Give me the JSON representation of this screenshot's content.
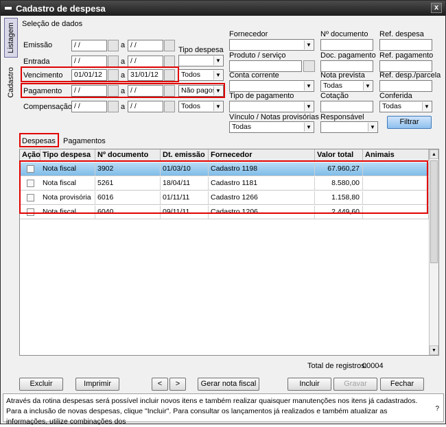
{
  "window": {
    "title": "Cadastro de despesa",
    "close": "x"
  },
  "side_tabs": [
    "Listagem",
    "Cadastro"
  ],
  "section_title": "Seleção de dados",
  "filters": {
    "sep": "a",
    "emissao": {
      "label": "Emissão",
      "from": " / /",
      "to": " / /"
    },
    "entrada": {
      "label": "Entrada",
      "from": " / /",
      "to": " / /"
    },
    "vencimento": {
      "label": "Vencimento",
      "from": "01/01/12",
      "to": "31/01/12",
      "select": "Todos"
    },
    "pagamento": {
      "label": "Pagamento",
      "from": " / /",
      "to": " / /",
      "select": "Não pagos"
    },
    "compensacao": {
      "label": "Compensação",
      "from": " / /",
      "to": " / /",
      "select": "Todos"
    },
    "tipo_despesa": {
      "label": "Tipo despesa",
      "value": ""
    },
    "fornecedor": {
      "label": "Fornecedor",
      "value": ""
    },
    "produto_servico": {
      "label": "Produto / serviço",
      "value": ""
    },
    "conta_corrente": {
      "label": "Conta corrente",
      "value": ""
    },
    "tipo_pagamento": {
      "label": "Tipo de pagamento",
      "value": ""
    },
    "vinculo": {
      "label": "Vínculo / Notas provisórias",
      "value": "Todas"
    },
    "n_documento": {
      "label": "Nº documento",
      "value": ""
    },
    "doc_pagamento": {
      "label": "Doc. pagamento",
      "value": ""
    },
    "nota_prevista": {
      "label": "Nota prevista",
      "value": "Todas"
    },
    "cotacao": {
      "label": "Cotação",
      "value": ""
    },
    "responsavel": {
      "label": "Responsável",
      "value": ""
    },
    "ref_despesa": {
      "label": "Ref. despesa",
      "value": ""
    },
    "ref_pagamento": {
      "label": "Ref. pagamento",
      "value": ""
    },
    "ref_parcela": {
      "label": "Ref. desp./parcela",
      "value": ""
    },
    "conferida": {
      "label": "Conferida",
      "value": "Todas"
    },
    "filter_button": "Filtrar"
  },
  "tabs": [
    "Despesas",
    "Pagamentos"
  ],
  "table": {
    "columns": [
      "Ação",
      "Tipo despesa",
      "Nº documento",
      "Dt. emissão",
      "Fornecedor",
      "Valor total",
      "Animais"
    ],
    "rows": [
      {
        "tipo": "Nota fiscal",
        "doc": "3902",
        "data": "01/03/10",
        "fornecedor": "Cadastro 1198",
        "valor": "67.960,27",
        "animais": ""
      },
      {
        "tipo": "Nota fiscal",
        "doc": "5261",
        "data": "18/04/11",
        "fornecedor": "Cadastro 1181",
        "valor": "8.580,00",
        "animais": ""
      },
      {
        "tipo": "Nota provisória",
        "doc": "6016",
        "data": "01/11/11",
        "fornecedor": "Cadastro 1266",
        "valor": "1.158,80",
        "animais": ""
      },
      {
        "tipo": "Nota fiscal",
        "doc": "6040",
        "data": "09/11/11",
        "fornecedor": "Cadastro 1206",
        "valor": "2.449,60",
        "animais": ""
      }
    ]
  },
  "total": {
    "label": "Total de registros:",
    "value": "00004"
  },
  "buttons": {
    "excluir": "Excluir",
    "imprimir": "Imprimir",
    "prev": "<",
    "next": ">",
    "gerar": "Gerar nota fiscal",
    "incluir": "Incluir",
    "gravar": "Gravar",
    "fechar": "Fechar"
  },
  "status_text": "Através da rotina despesas será possível incluir novos itens e também realizar quaisquer manutenções nos itens já cadastrados. Para a inclusão de novas despesas, clique \"Incluir\". Para consultar os lançamentos já realizados e também atualizar as informações, utilize combinações dos",
  "status_help": "?",
  "icons": {
    "dropdown": "▼",
    "scroll_up": "▲",
    "scroll_down": "▼"
  }
}
